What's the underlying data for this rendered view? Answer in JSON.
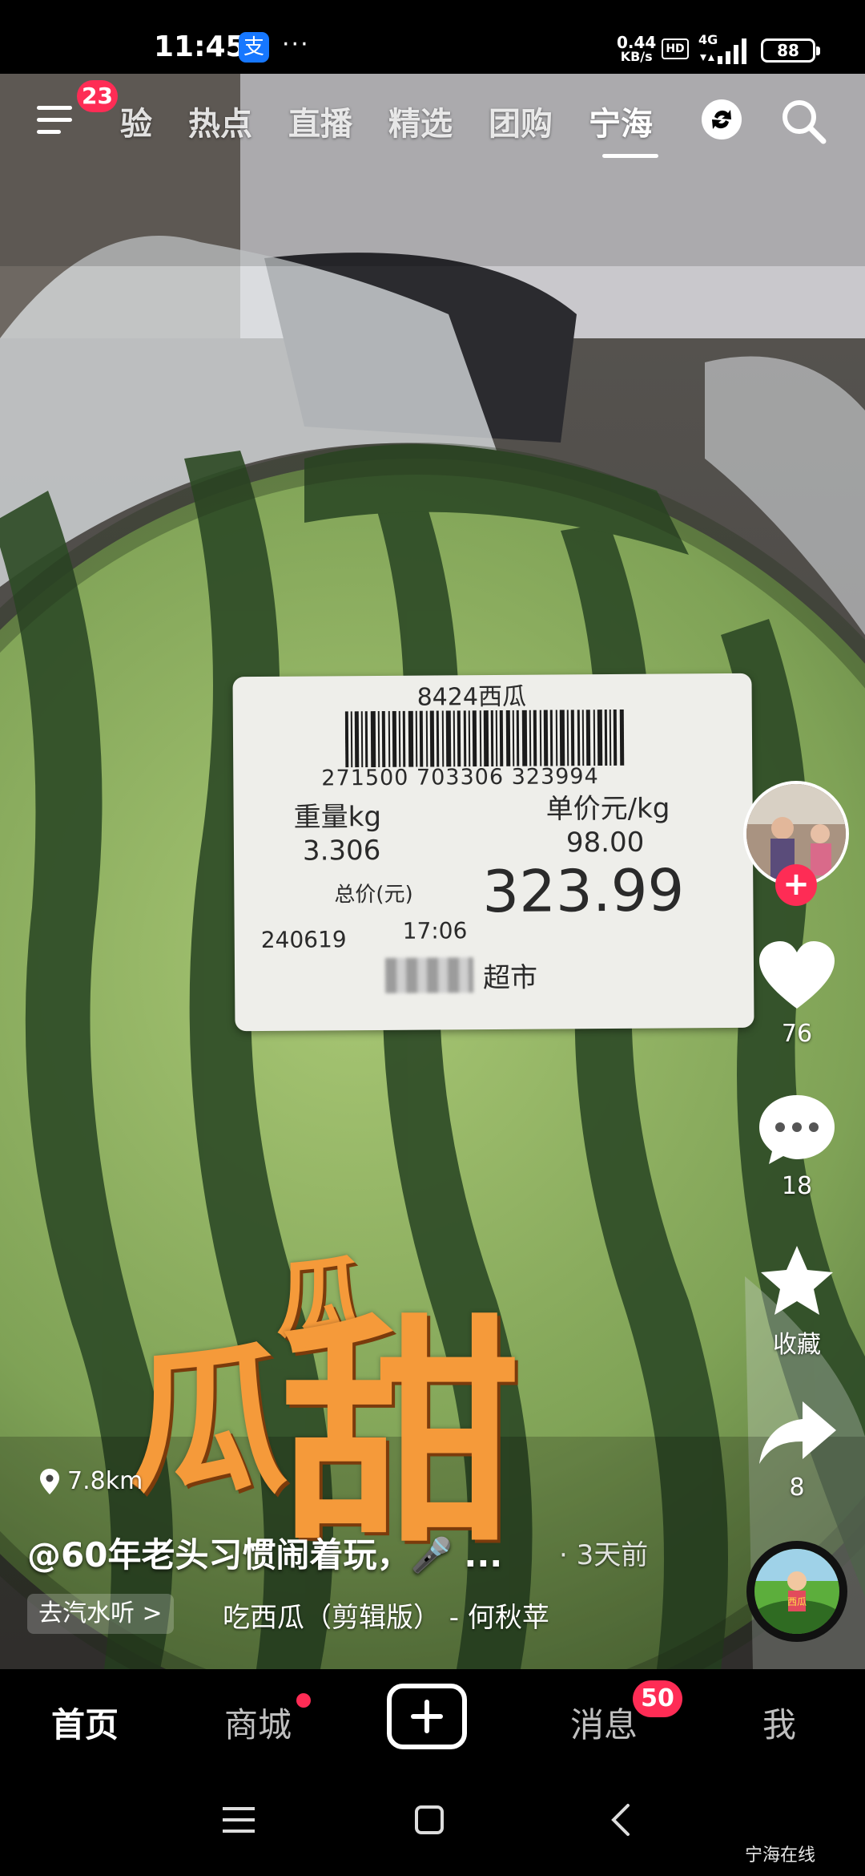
{
  "status_bar": {
    "time": "11:45",
    "alipay_glyph": "支",
    "more": "···",
    "net_speed": "0.44",
    "net_unit": "KB/s",
    "hd": "HD",
    "network": "4G",
    "battery": "88"
  },
  "top_nav": {
    "notification_count": "23",
    "tabs": [
      "验",
      "热点",
      "直播",
      "精选",
      "团购",
      "宁海"
    ],
    "active_tab": "宁海",
    "icons": [
      "menu-icon",
      "refresh-icon",
      "search-icon"
    ]
  },
  "price_label": {
    "product": "8424西瓜",
    "barcode_number": "271500 703306 323994",
    "weight_header": "重量kg",
    "unit_price_header": "单价元/kg",
    "weight": "3.306",
    "unit_price": "98.00",
    "total_header": "总价(元)",
    "total": "323.99",
    "date": "240619",
    "time": "17:06",
    "store_suffix": "超市"
  },
  "overlay_text": {
    "small": "瓜",
    "medium": "瓜",
    "large": "甜"
  },
  "right_rail": {
    "likes": "76",
    "comments": "18",
    "favorite_label": "收藏",
    "shares": "8"
  },
  "video_info": {
    "distance": "7.8km",
    "author_line": "@60年老头习惯闹着玩，🎤 ...",
    "posted": "· 3天前",
    "listen_button": "去汽水听 >",
    "music": "吃西瓜（剪辑版） - 何秋苹"
  },
  "bottom_tabs": {
    "home": "首页",
    "mall": "商城",
    "messages": "消息",
    "messages_badge": "50",
    "me": "我"
  },
  "watermark": "宁海在线",
  "colors": {
    "accent": "#fe2c55",
    "overlay_text": "#f59a3a",
    "watermelon_light": "#9cc06a",
    "watermelon_dark": "#2d4a26"
  }
}
